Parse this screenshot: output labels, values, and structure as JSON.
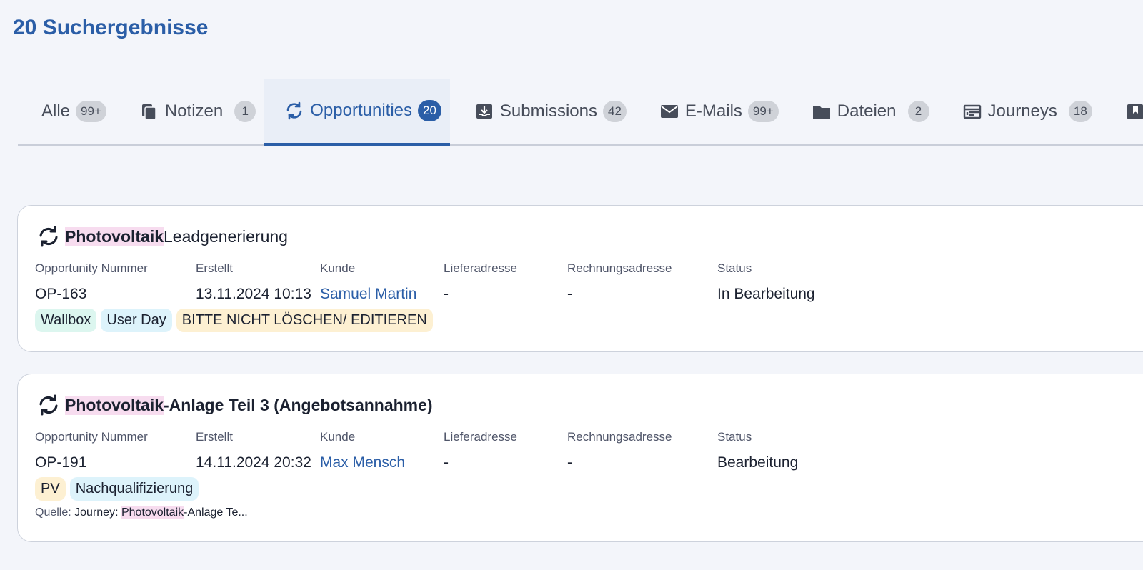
{
  "header": {
    "title": "20 Suchergebnisse"
  },
  "tabs": [
    {
      "label": "Alle",
      "count": "99+",
      "icon": "none"
    },
    {
      "label": "Notizen",
      "count": "1",
      "icon": "notes-icon"
    },
    {
      "label": "Opportunities",
      "count": "20",
      "icon": "refresh-icon",
      "active": true
    },
    {
      "label": "Submissions",
      "count": "42",
      "icon": "inbox-download-icon"
    },
    {
      "label": "E-Mails",
      "count": "99+",
      "icon": "mail-icon"
    },
    {
      "label": "Dateien",
      "count": "2",
      "icon": "folder-icon"
    },
    {
      "label": "Journeys",
      "count": "18",
      "icon": "journey-window-icon"
    }
  ],
  "fields": {
    "number": "Opportunity Nummer",
    "created": "Erstellt",
    "customer": "Kunde",
    "delivery": "Lieferadresse",
    "billing": "Rechnungsadresse",
    "status": "Status"
  },
  "results": [
    {
      "title_highlight": "Photovoltaik",
      "title_rest": " Leadgenerierung",
      "number": "OP-163",
      "created": "13.11.2024 10:13",
      "customer": "Samuel Martin",
      "delivery": "-",
      "billing": "-",
      "status": "In Bearbeitung",
      "tags": [
        "Wallbox",
        "User Day",
        "BITTE NICHT LÖSCHEN/ EDITIEREN"
      ]
    },
    {
      "title_highlight": "Photovoltaik",
      "title_rest": "-Anlage Teil 3 (Angebotsannahme)",
      "number": "OP-191",
      "created": "14.11.2024 20:32",
      "customer": "Max Mensch",
      "delivery": "-",
      "billing": "-",
      "status": "Bearbeitung",
      "tags": [
        "PV",
        "Nachqualifizierung"
      ],
      "source_label": "Quelle:",
      "source_prefix": "Journey: ",
      "source_highlight": "Photovoltaik",
      "source_rest": "-Anlage Te..."
    }
  ],
  "colors": {
    "accent": "#2b5ea7",
    "highlight": "#f7dcef",
    "tag_green": "#dcf6ef",
    "tag_cyan": "#ddf3fb",
    "tag_yellow": "#fdf0d2"
  }
}
